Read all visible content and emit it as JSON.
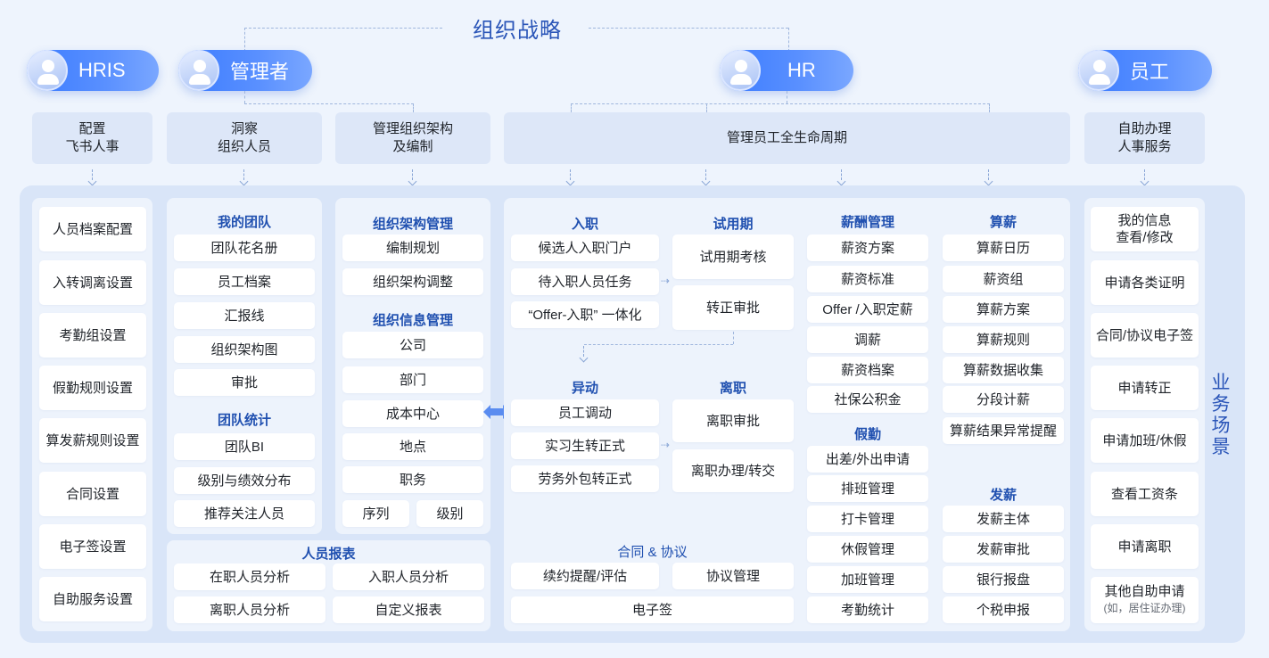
{
  "title": "组织战略",
  "roles": [
    "HRIS",
    "管理者",
    "HR",
    "员工"
  ],
  "categories": {
    "hris": [
      "配置",
      "飞书人事"
    ],
    "manager_insight": [
      "洞察",
      "组织人员"
    ],
    "manager_org": [
      "管理组织架构",
      "及编制"
    ],
    "hr": "管理员工全生命周期",
    "employee": [
      "自助办理",
      "人事服务"
    ]
  },
  "hris_items": [
    "人员档案配置",
    "入转调离设置",
    "考勤组设置",
    "假勤规则设置",
    "算发薪规则设置",
    "合同设置",
    "电子签设置",
    "自助服务设置"
  ],
  "team": {
    "title": "我的团队",
    "items": [
      "团队花名册",
      "员工档案",
      "汇报线",
      "组织架构图",
      "审批"
    ],
    "stats_title": "团队统计",
    "stats": [
      "团队BI",
      "级别与绩效分布",
      "推荐关注人员"
    ]
  },
  "org": {
    "title": "组织架构管理",
    "items": [
      "编制规划",
      "组织架构调整"
    ],
    "info_title": "组织信息管理",
    "info": [
      "公司",
      "部门",
      "成本中心",
      "地点",
      "职务"
    ],
    "seq": "序列",
    "level": "级别"
  },
  "reports": {
    "title": "人员报表",
    "items": [
      "在职人员分析",
      "入职人员分析",
      "离职人员分析",
      "自定义报表"
    ]
  },
  "onboard": {
    "title": "入职",
    "items": [
      "候选人入职门户",
      "待入职人员任务",
      "“Offer-入职” 一体化"
    ]
  },
  "probation": {
    "title": "试用期",
    "items": [
      "试用期考核",
      "转正审批"
    ]
  },
  "transfer": {
    "title": "异动",
    "items": [
      "员工调动",
      "实习生转正式",
      "劳务外包转正式"
    ]
  },
  "leave": {
    "title": "离职",
    "items": [
      "离职审批",
      "离职办理/转交"
    ]
  },
  "contract": {
    "title": "合同 & 协议",
    "items": [
      "续约提醒/评估",
      "协议管理",
      "电子签"
    ]
  },
  "comp": {
    "title": "薪酬管理",
    "items": [
      "薪资方案",
      "薪资标准",
      "Offer /入职定薪",
      "调薪",
      "薪资档案",
      "社保公积金"
    ]
  },
  "attendance": {
    "title": "假勤",
    "items": [
      "出差/外出申请",
      "排班管理",
      "打卡管理",
      "休假管理",
      "加班管理",
      "考勤统计"
    ]
  },
  "payroll": {
    "title": "算薪",
    "items": [
      "算薪日历",
      "薪资组",
      "算薪方案",
      "算薪规则",
      "算薪数据收集",
      "分段计薪",
      "算薪结果异常提醒"
    ]
  },
  "payout": {
    "title": "发薪",
    "items": [
      "发薪主体",
      "发薪审批",
      "银行报盘",
      "个税申报"
    ]
  },
  "employee": {
    "items": [
      [
        "我的信息",
        "查看/修改"
      ],
      "申请各类证明",
      "合同/协议电子签",
      "申请转正",
      "申请加班/休假",
      "查看工资条",
      "申请离职"
    ],
    "other": "其他自助申请",
    "other_note": "(如，居住证办理)"
  },
  "side_label": [
    "业",
    "务",
    "场",
    "景"
  ]
}
